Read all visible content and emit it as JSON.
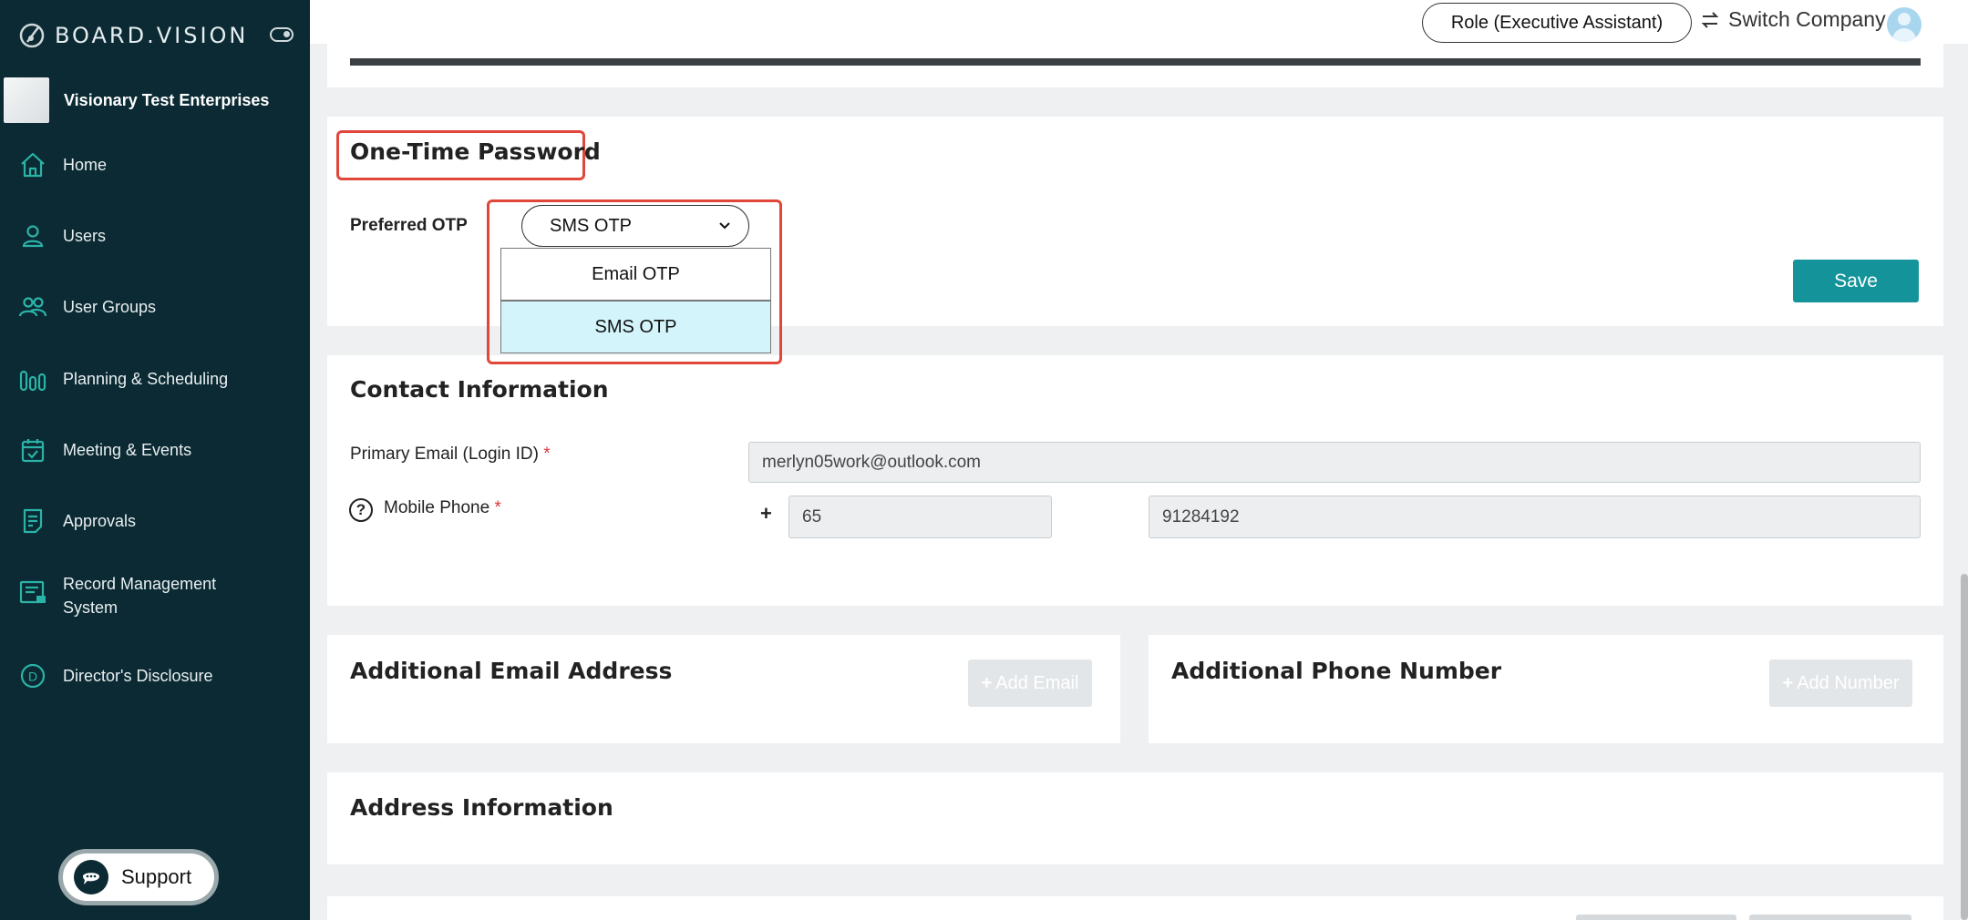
{
  "brand": {
    "name": "BOARD.VISION"
  },
  "company": {
    "name": "Visionary Test Enterprises"
  },
  "sidebar": {
    "items": [
      {
        "label": "Home",
        "icon": "home-icon"
      },
      {
        "label": "Users",
        "icon": "user-icon"
      },
      {
        "label": "User Groups",
        "icon": "users-icon"
      },
      {
        "label": "Planning & Scheduling",
        "icon": "bars-icon"
      },
      {
        "label": "Meeting & Events",
        "icon": "calendar-icon"
      },
      {
        "label": "Approvals",
        "icon": "document-icon"
      },
      {
        "label": "Record Management",
        "label2": "System",
        "icon": "folder-icon"
      },
      {
        "label": "Director's Disclosure",
        "icon": "d-circle-icon"
      }
    ],
    "support_label": "Support"
  },
  "header": {
    "role": "Role (Executive Assistant)",
    "switch_company": "Switch Company"
  },
  "otp": {
    "title": "One-Time Password",
    "preferred_label": "Preferred OTP",
    "selected": "SMS OTP",
    "options": [
      "Email OTP",
      "SMS OTP"
    ],
    "save_label": "Save"
  },
  "contact": {
    "title": "Contact Information",
    "email_label": "Primary Email (Login ID)",
    "email_value": "merlyn05work@outlook.com",
    "phone_label": "Mobile Phone",
    "required_mark": "*",
    "plus": "+",
    "country_code": "65",
    "phone_value": "91284192"
  },
  "additional_email": {
    "title": "Additional Email Address",
    "add_label": "Add Email"
  },
  "additional_phone": {
    "title": "Additional Phone Number",
    "add_label": "Add Number"
  },
  "address": {
    "title": "Address Information"
  },
  "colors": {
    "sidebar": "#0b2a33",
    "accent": "#14949a",
    "highlight": "#e0463a",
    "selected_option": "#d3f4fa"
  }
}
